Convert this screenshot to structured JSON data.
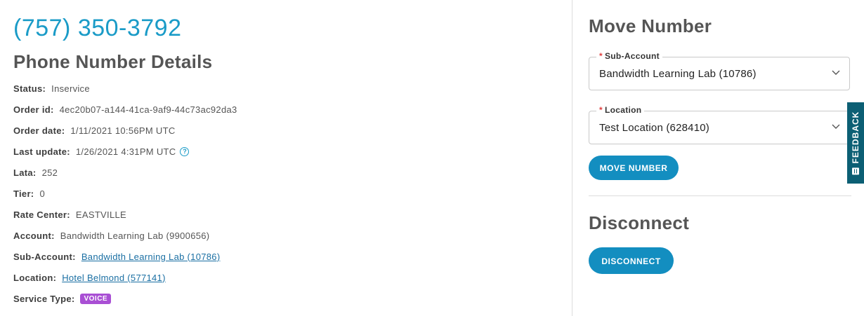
{
  "phone_number": "(757) 350-3792",
  "details": {
    "title": "Phone Number Details",
    "rows": [
      {
        "label": "Status:",
        "value": "Inservice"
      },
      {
        "label": "Order id:",
        "value": "4ec20b07-a144-41ca-9af9-44c73ac92da3"
      },
      {
        "label": "Order date:",
        "value": "1/11/2021 10:56PM UTC"
      },
      {
        "label": "Last update:",
        "value": "1/26/2021 4:31PM UTC"
      },
      {
        "label": "Lata:",
        "value": "252"
      },
      {
        "label": "Tier:",
        "value": "0"
      },
      {
        "label": "Rate Center:",
        "value": "EASTVILLE"
      },
      {
        "label": "Account:",
        "value": "Bandwidth Learning Lab (9900656)"
      },
      {
        "label": "Sub-Account:",
        "value": "Bandwidth Learning Lab (10786)"
      },
      {
        "label": "Location:",
        "value": "Hotel Belmond (577141)"
      },
      {
        "label": "Service Type:",
        "value": "VOICE"
      }
    ],
    "help_icon_glyph": "?"
  },
  "move": {
    "title": "Move Number",
    "sub_account": {
      "required_mark": "*",
      "label": "Sub-Account",
      "value": "Bandwidth Learning Lab (10786)"
    },
    "location": {
      "required_mark": "*",
      "label": "Location",
      "value": "Test Location (628410)"
    },
    "button_label": "MOVE NUMBER"
  },
  "disconnect": {
    "title": "Disconnect",
    "button_label": "DISCONNECT"
  },
  "feedback": {
    "label": "FEEDBACK",
    "icon": "feedback-icon"
  },
  "colors": {
    "accent": "#1a9bc7",
    "button": "#138ec0",
    "badge": "#a94fd4",
    "feedback_tab": "#0c5f74",
    "required": "#e04040"
  }
}
